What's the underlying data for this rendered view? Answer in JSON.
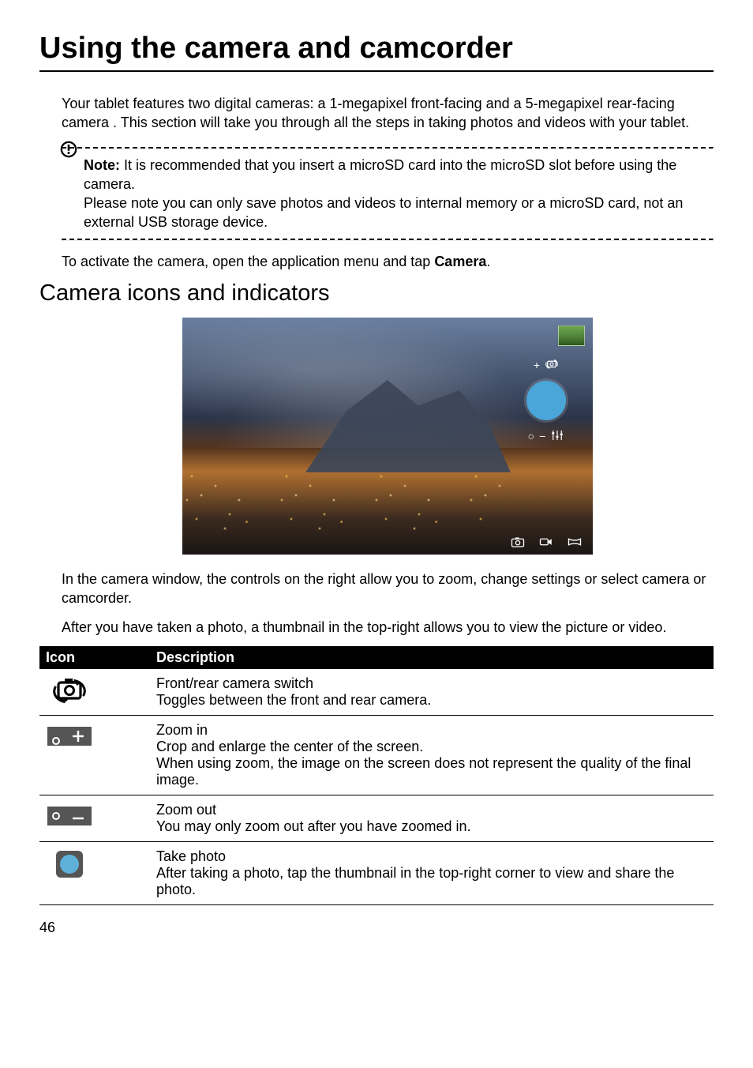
{
  "page": {
    "number": "46",
    "title": "Using the camera and camcorder"
  },
  "intro": "Your tablet features two digital cameras: a 1-megapixel front-facing and a 5-megapixel rear-facing camera . This section will take you through all the steps in taking photos and videos with your tablet.",
  "note": {
    "label": "Note:",
    "line1": " It is recommended that you insert a microSD card into the microSD slot before using the camera.",
    "line2": "Please note you can only save photos and videos to internal memory or a microSD card, not an external USB storage device."
  },
  "activate": {
    "prefix": "To activate the camera, open the application menu and tap ",
    "bold": "Camera",
    "suffix": "."
  },
  "section_title": "Camera icons and indicators",
  "post_figure_p1": "In the camera window, the controls on the right allow you to zoom, change settings or select camera or camcorder.",
  "post_figure_p2": "After you have taken a photo, a thumbnail in the top-right allows you to view the picture or video.",
  "camera_ui": {
    "zoom_in_symbol": "+",
    "zoom_out_symbol": "−",
    "zoom_slider_symbol": "○"
  },
  "table": {
    "headers": {
      "icon": "Icon",
      "description": "Description"
    },
    "rows": [
      {
        "icon_name": "camera-switch-icon",
        "title": "Front/rear camera switch",
        "desc": "Toggles between the front and rear camera."
      },
      {
        "icon_name": "zoom-in-icon",
        "title": "Zoom in",
        "desc": "Crop and enlarge the center of the screen.\nWhen using zoom, the image on the screen does not represent the quality of the final image."
      },
      {
        "icon_name": "zoom-out-icon",
        "title": "Zoom out",
        "desc": "You may only zoom out after you have zoomed in."
      },
      {
        "icon_name": "take-photo-icon",
        "title": "Take photo",
        "desc": "After taking a photo, tap the thumbnail in the top-right corner to view and share the photo."
      }
    ]
  }
}
